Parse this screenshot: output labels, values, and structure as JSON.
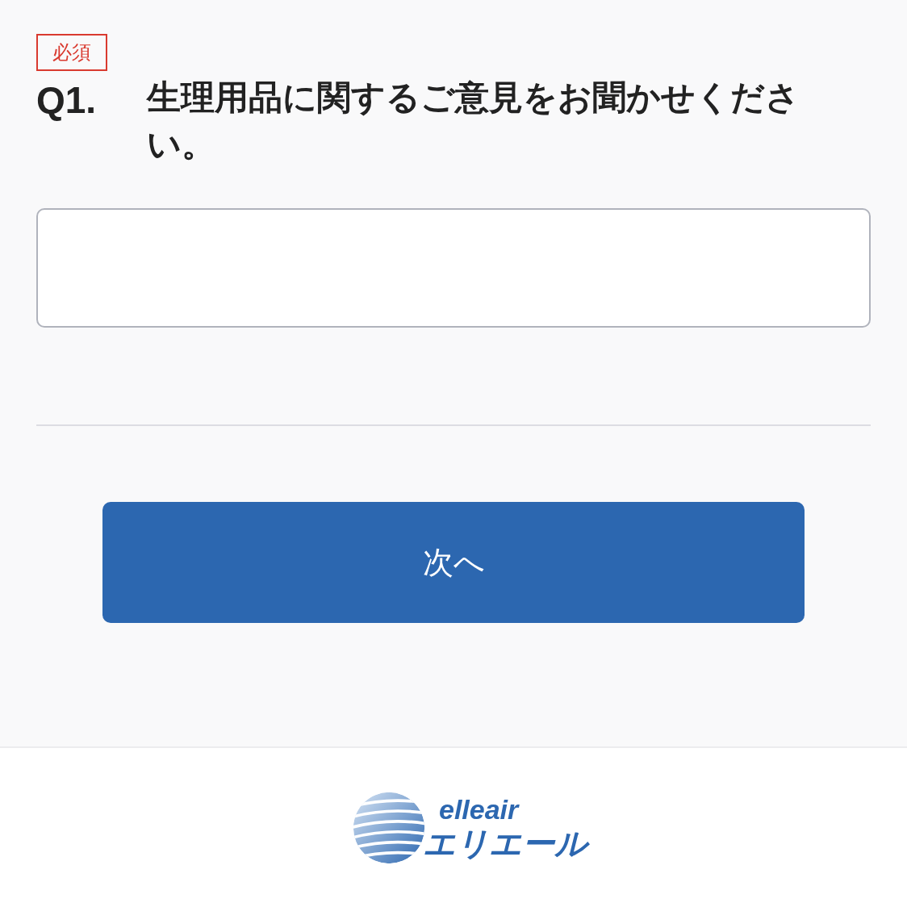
{
  "question": {
    "required_badge": "必須",
    "number": "Q1.",
    "text": "生理用品に関するご意見をお聞かせください。"
  },
  "next_button": "次へ",
  "footer": {
    "logo_text": "elleair",
    "logo_kana": "エリエール"
  }
}
